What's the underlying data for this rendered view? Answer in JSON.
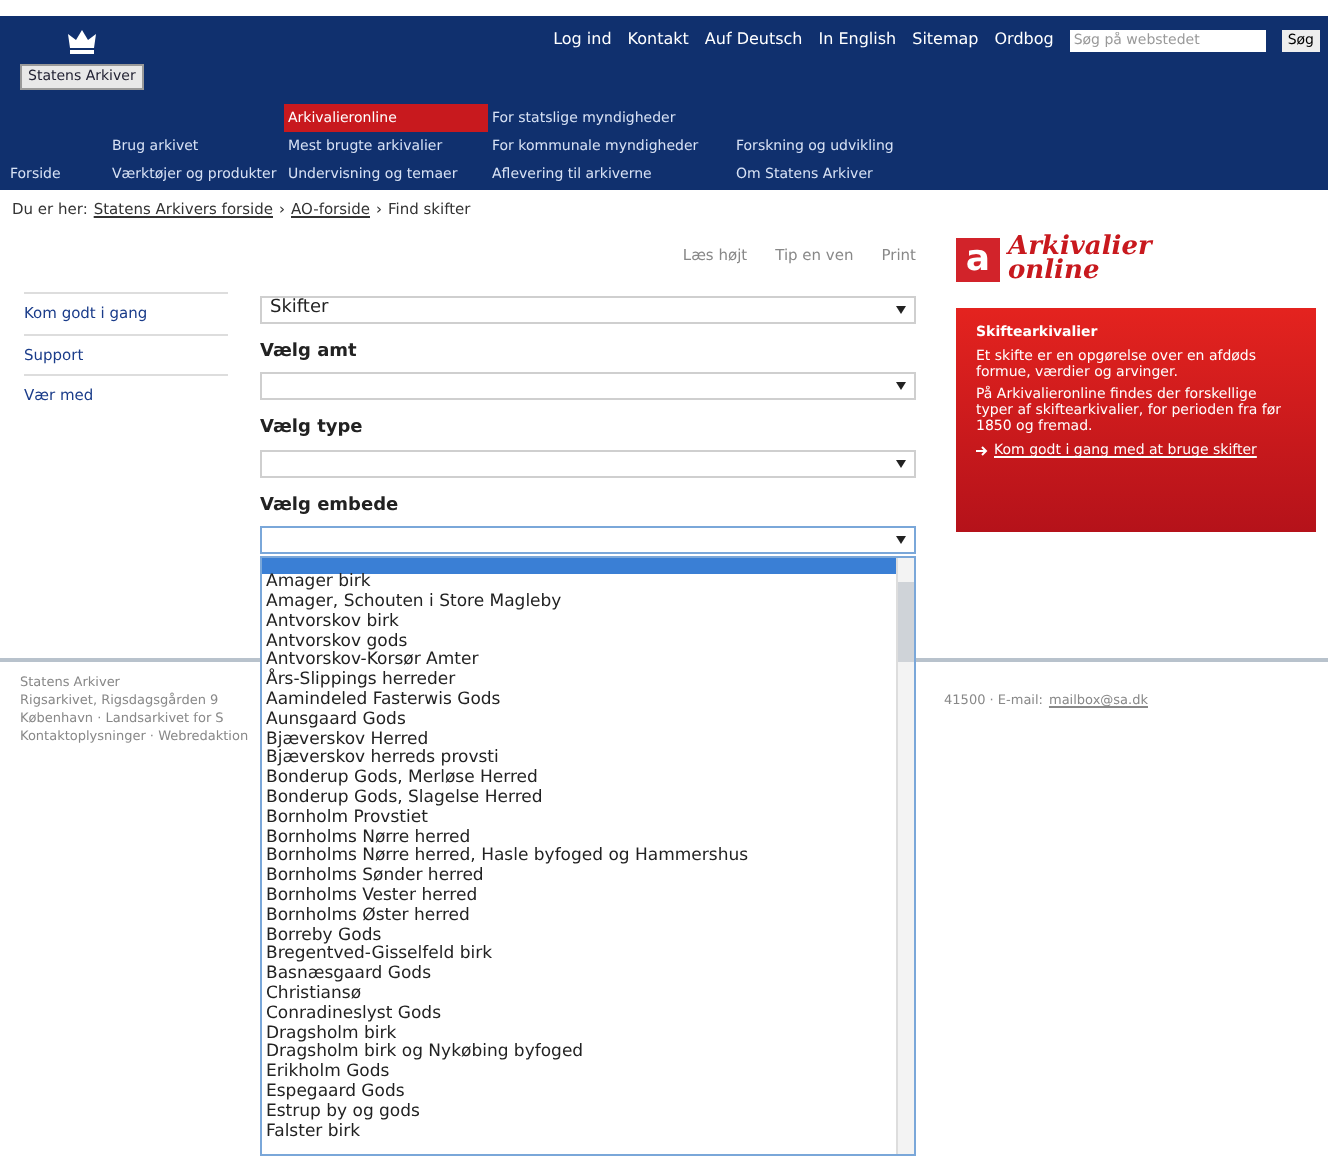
{
  "header": {
    "logo_label": "Statens Arkiver",
    "top_links": [
      "Log ind",
      "Kontakt",
      "Auf Deutsch",
      "In English",
      "Sitemap",
      "Ordbog"
    ],
    "search": {
      "placeholder": "Søg på webstedet"
    },
    "search_button": "Søg"
  },
  "nav": {
    "columns": [
      [
        {
          "label": "Forside",
          "selected": false
        }
      ],
      [
        {
          "label": "Brug arkivet",
          "selected": false
        },
        {
          "label": "Værktøjer og produkter",
          "selected": false
        }
      ],
      [
        {
          "label": "Arkivalieronline",
          "selected": true
        },
        {
          "label": "Mest brugte arkivalier",
          "selected": false
        },
        {
          "label": "Undervisning og temaer",
          "selected": false
        }
      ],
      [
        {
          "label": "For statslige myndigheder",
          "selected": false
        },
        {
          "label": "For kommunale myndigheder",
          "selected": false
        },
        {
          "label": "Aflevering til arkiverne",
          "selected": false
        }
      ],
      [
        {
          "label": "Forskning og udvikling",
          "selected": false
        },
        {
          "label": "Om Statens Arkiver",
          "selected": false
        }
      ]
    ]
  },
  "breadcrumb": {
    "prefix": "Du er her:",
    "links": [
      "Statens Arkivers forside",
      "AO-forside"
    ],
    "current": "Find skifter",
    "separator": "›"
  },
  "tools": [
    "Læs højt",
    "Tip en ven",
    "Print"
  ],
  "sidebar": {
    "items": [
      "Kom godt i gang",
      "Support",
      "Vær med"
    ]
  },
  "form": {
    "first_select": "Skifter",
    "fields": [
      {
        "label": "Vælg amt",
        "expanded": false
      },
      {
        "label": "Vælg type",
        "expanded": false
      },
      {
        "label": "Vælg embede",
        "expanded": true
      }
    ]
  },
  "dropdown": {
    "options": [
      {
        "selected": true
      }
    ],
    "items": [
      "Amager birk",
      "Amager, Schouten i Store Magleby",
      "Antvorskov birk",
      "Antvorskov gods",
      "Antvorskov-Korsør Amter",
      "Års-Slippings herreder",
      "Aamindeled Fasterwis Gods",
      "Aunsgaard Gods",
      "Bjæverskov Herred",
      "Bjæverskov herreds provsti",
      "Bonderup Gods, Merløse Herred",
      "Bonderup Gods, Slagelse Herred",
      "Bornholm Provstiet",
      "Bornholms Nørre herred",
      "Bornholms Nørre herred, Hasle byfoged og Hammershus",
      "Bornholms Sønder herred",
      "Bornholms Vester herred",
      "Bornholms Øster herred",
      "Borreby Gods",
      "Bregentved-Gisselfeld birk",
      "Basnæsgaard Gods",
      "Christiansø",
      "Conradineslyst Gods",
      "Dragsholm birk",
      "Dragsholm birk og Nykøbing byfoged",
      "Erikholm Gods",
      "Espegaard Gods",
      "Estrup by og gods",
      "Falster birk"
    ]
  },
  "brand": {
    "letter": "a",
    "line1": "Arkivalier",
    "line2": "online"
  },
  "info_panel": {
    "title": "Skiftearkivalier",
    "paragraphs": [
      "Et skifte er en opgørelse over en afdøds formue, værdier og arvinger.",
      "På Arkivalieronline findes der forskellige typer af skiftearkivalier, for perioden fra før 1850 og fremad."
    ],
    "link": "Kom godt i gang med at bruge skifter"
  },
  "footer": {
    "lines": [
      "Statens Arkiver",
      "Rigsarkivet, Rigsdagsgården 9",
      "København · Landsarkivet for S",
      "Kontaktoplysninger · Webredaktion"
    ],
    "contact_prefix": "41500 · E-mail:",
    "email": "mailbox@sa.dk"
  }
}
